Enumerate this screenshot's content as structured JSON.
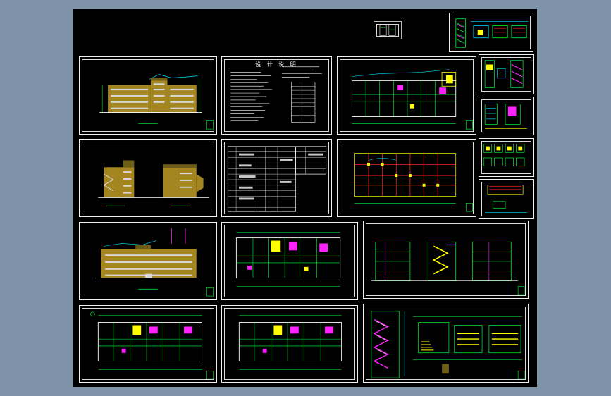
{
  "drawing": {
    "background": "#000000",
    "viewport_background": "#7f93a8",
    "frame_color": "#f0f0f0"
  },
  "notes_sheet": {
    "heading": "设 计 说 明"
  },
  "palette": {
    "facade_fill": "#a3861f",
    "facade_dark": "#6e5d17",
    "window": "#d8d8d8",
    "grid_red": "#ff2020",
    "line_green": "#00ff3a",
    "line_yellow": "#ffff00",
    "line_cyan": "#00e0ff",
    "line_magenta": "#ff22ff",
    "line_white": "#ffffff"
  }
}
